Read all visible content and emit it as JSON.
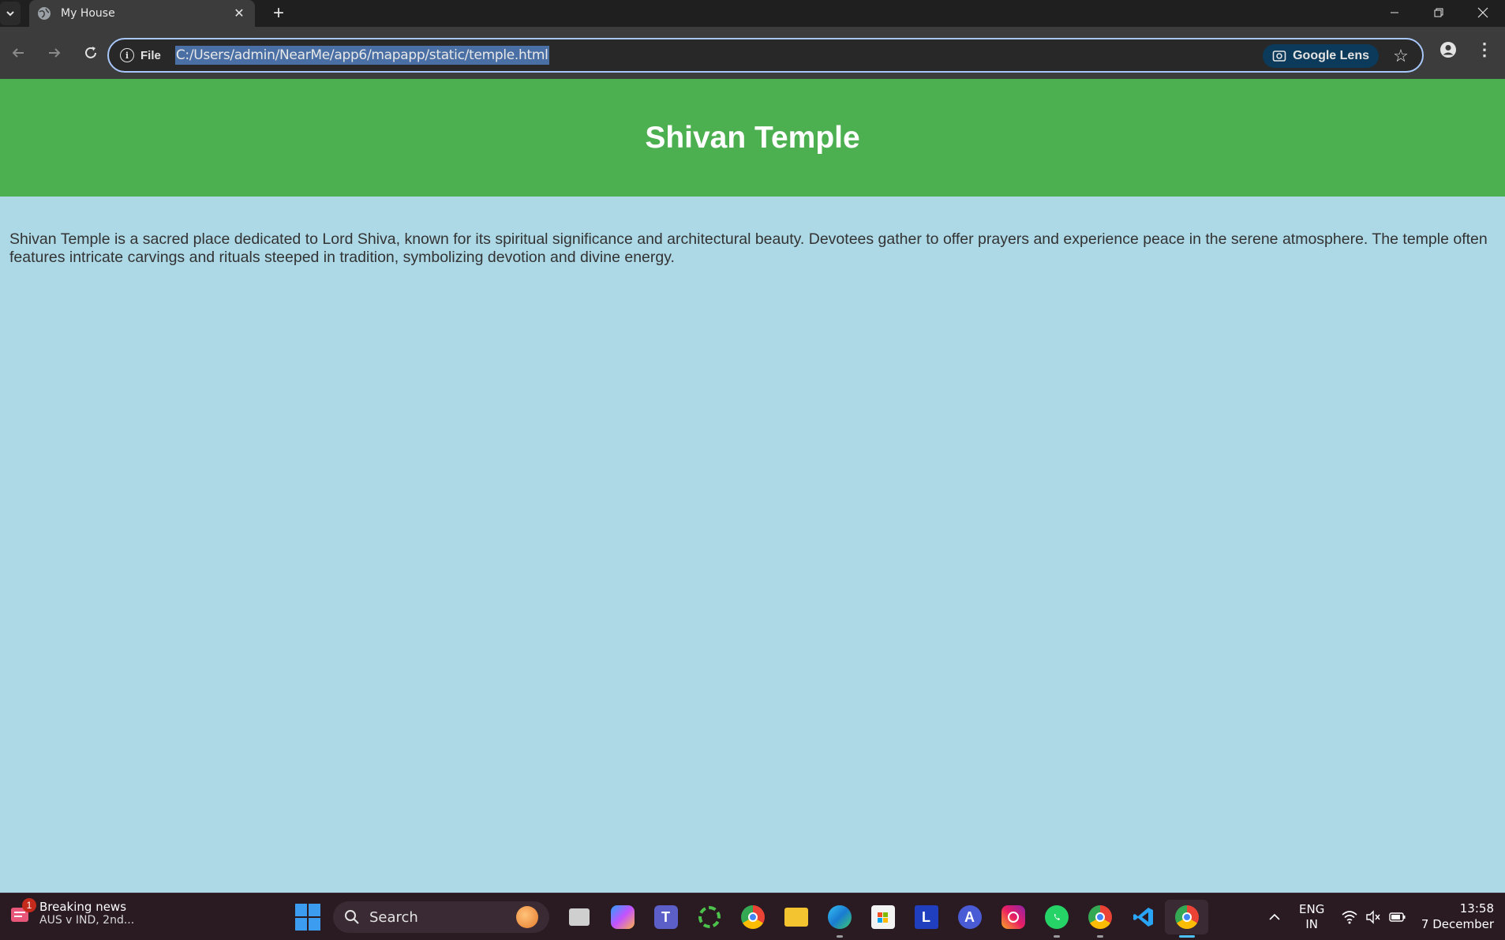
{
  "browser": {
    "tab_title": "My House",
    "site_info_label": "File",
    "url": "C:/Users/admin/NearMe/app6/mapapp/static/temple.html",
    "lens_label": "Google Lens"
  },
  "page": {
    "title": "Shivan Temple",
    "description": "Shivan Temple is a sacred place dedicated to Lord Shiva, known for its spiritual significance and architectural beauty. Devotees gather to offer prayers and experience peace in the serene atmosphere. The temple often features intricate carvings and rituals steeped in tradition, symbolizing devotion and divine energy.",
    "header_color": "#4caf50",
    "background_color": "#add8e6"
  },
  "taskbar": {
    "news_badge": "1",
    "news_title": "Breaking news",
    "news_subtitle": "AUS v IND, 2nd...",
    "search_label": "Search",
    "language_line1": "ENG",
    "language_line2": "IN",
    "time": "13:58",
    "date": "7 December",
    "apps": [
      "task-view",
      "copilot",
      "teams",
      "app-ring",
      "chrome",
      "file-explorer",
      "edge",
      "microsoft-store",
      "l-app",
      "app-a",
      "instagram",
      "whatsapp",
      "chrome-alt",
      "vscode",
      "chrome-active"
    ]
  }
}
